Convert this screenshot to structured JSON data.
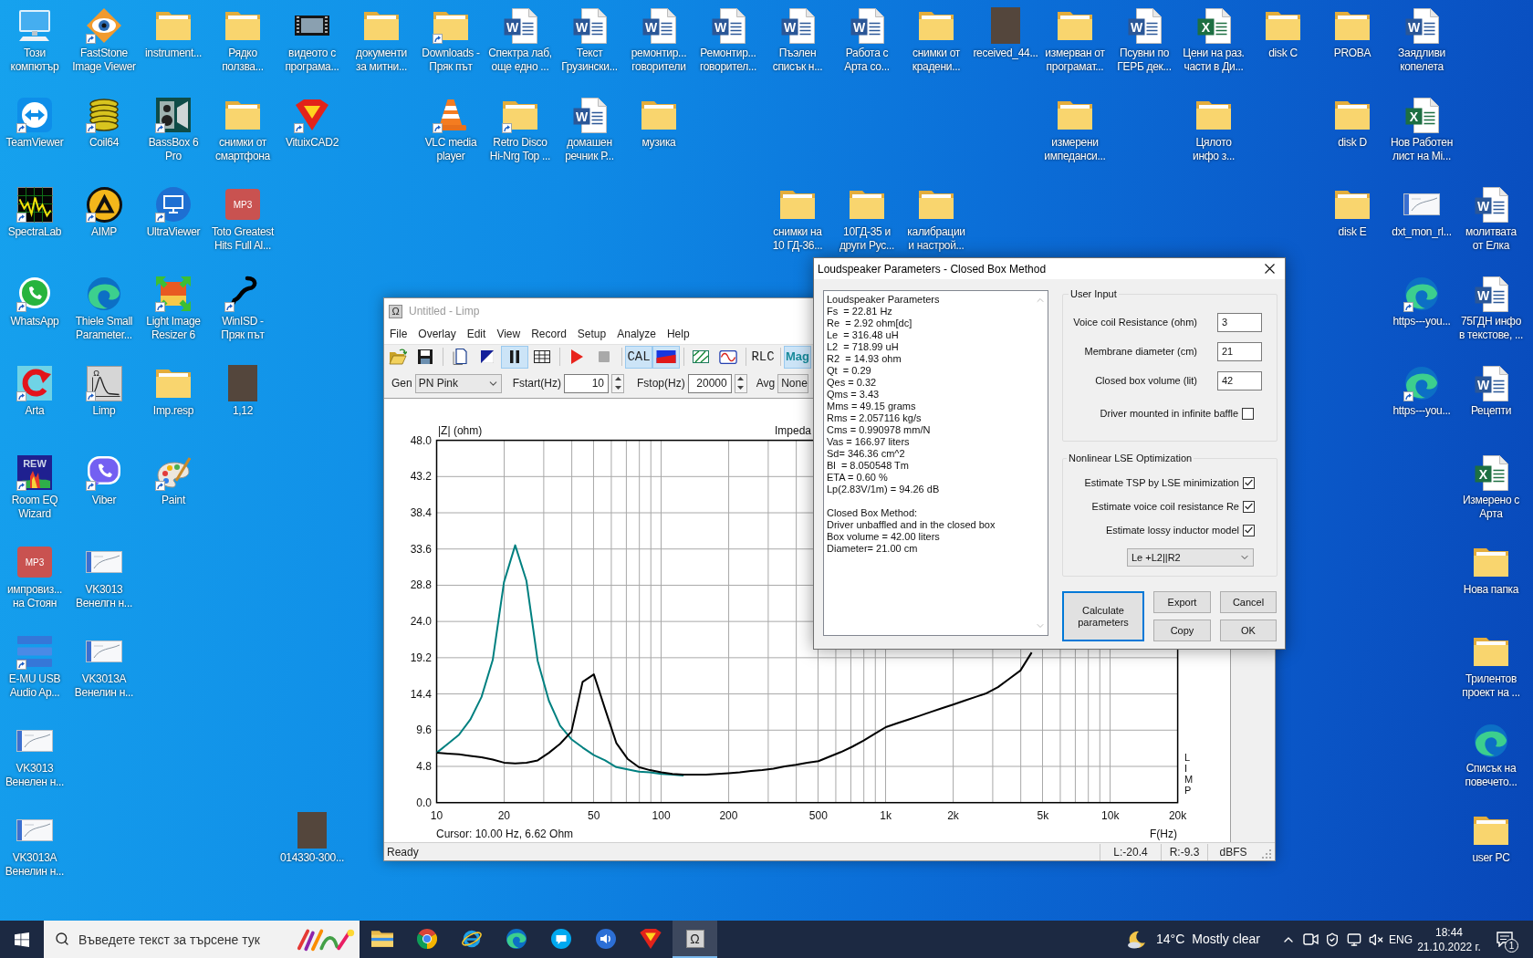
{
  "desktop": {
    "icons": [
      {
        "label_lines": [
          "Този",
          "компютър"
        ],
        "kind": "computer",
        "shortcut": false
      },
      {
        "label_lines": [
          "FastStone",
          "Image Viewer"
        ],
        "kind": "eye",
        "shortcut": true
      },
      {
        "label_lines": [
          "instrument..."
        ],
        "kind": "folder",
        "shortcut": false
      },
      {
        "label_lines": [
          "Рядко",
          "ползва..."
        ],
        "kind": "folder",
        "shortcut": false
      },
      {
        "label_lines": [
          "видеото с",
          "програма..."
        ],
        "kind": "video",
        "shortcut": false
      },
      {
        "label_lines": [
          "документи",
          "за митни..."
        ],
        "kind": "folder",
        "shortcut": false
      },
      {
        "label_lines": [
          "Downloads -",
          "Пряк път"
        ],
        "kind": "folder",
        "shortcut": true
      },
      {
        "label_lines": [
          "Спектра лаб,",
          "още едно ..."
        ],
        "kind": "word",
        "shortcut": false,
        "badge": "W"
      },
      {
        "label_lines": [
          "Текст",
          "Грузински..."
        ],
        "kind": "word",
        "shortcut": false,
        "badge": "W"
      },
      {
        "label_lines": [
          "ремонтир...",
          "говорители"
        ],
        "kind": "word",
        "shortcut": false,
        "badge": "W"
      },
      {
        "label_lines": [
          "Ремонтир...",
          "говорител..."
        ],
        "kind": "word",
        "shortcut": false,
        "badge": "W"
      },
      {
        "label_lines": [
          "Пъэлен",
          "списък н..."
        ],
        "kind": "word",
        "shortcut": false,
        "badge": "W"
      },
      {
        "label_lines": [
          "Работа с",
          "Арта со..."
        ],
        "kind": "word",
        "shortcut": false,
        "badge": "W"
      },
      {
        "label_lines": [
          "снимки от",
          "крадени..."
        ],
        "kind": "folder",
        "shortcut": false
      },
      {
        "label_lines": [
          "received_44..."
        ],
        "kind": "photo",
        "shortcut": false
      },
      {
        "label_lines": [
          "измерван от",
          "програмат..."
        ],
        "kind": "folder",
        "shortcut": false
      },
      {
        "label_lines": [
          "Псувни по",
          "ГЕРБ дек..."
        ],
        "kind": "word",
        "shortcut": false,
        "badge": "W"
      },
      {
        "label_lines": [
          "Цени на раз.",
          "части в Ди..."
        ],
        "kind": "excel",
        "shortcut": false,
        "badge": "X"
      },
      {
        "label_lines": [
          "disk C"
        ],
        "kind": "folder",
        "shortcut": false
      },
      {
        "label_lines": [
          "PROBA"
        ],
        "kind": "folder",
        "shortcut": false
      },
      {
        "label_lines": [
          "Заядливи",
          "копелета"
        ],
        "kind": "word",
        "shortcut": false,
        "badge": "W"
      },
      {
        "label_lines": [
          "TeamViewer"
        ],
        "kind": "double-arrow",
        "shortcut": true
      },
      {
        "label_lines": [
          "Coil64"
        ],
        "kind": "coil",
        "shortcut": true
      },
      {
        "label_lines": [
          "BassBox 6",
          "Pro"
        ],
        "kind": "speaker-box",
        "shortcut": true
      },
      {
        "label_lines": [
          "снимки от",
          "смартфона"
        ],
        "kind": "folder",
        "shortcut": false
      },
      {
        "label_lines": [
          "VituixCAD2"
        ],
        "kind": "shield",
        "shortcut": true
      },
      {
        "label_lines": [
          "VLC media",
          "player"
        ],
        "kind": "cone",
        "shortcut": true
      },
      {
        "label_lines": [
          "Retro Disco",
          "Hi-Nrg Top ..."
        ],
        "kind": "folder",
        "shortcut": true
      },
      {
        "label_lines": [
          "домашен",
          "речник Р..."
        ],
        "kind": "word",
        "shortcut": false,
        "badge": "W"
      },
      {
        "label_lines": [
          "музика"
        ],
        "kind": "folder",
        "shortcut": false
      },
      {
        "label_lines": [
          "измерени",
          "импеданси..."
        ],
        "kind": "folder",
        "shortcut": false
      },
      {
        "label_lines": [
          "Цялото",
          "инфо з..."
        ],
        "kind": "folder",
        "shortcut": false
      },
      {
        "label_lines": [
          "disk D"
        ],
        "kind": "folder",
        "shortcut": false
      },
      {
        "label_lines": [
          "Нов Работен",
          "лист на Mi..."
        ],
        "kind": "excel",
        "shortcut": false,
        "badge": "X"
      },
      {
        "label_lines": [
          "SpectraLab"
        ],
        "kind": "spectrum",
        "shortcut": true
      },
      {
        "label_lines": [
          "AIMP"
        ],
        "kind": "triangle",
        "shortcut": true
      },
      {
        "label_lines": [
          "UltraViewer"
        ],
        "kind": "monitor",
        "shortcut": true
      },
      {
        "label_lines": [
          "Toto Greatest",
          "Hits Full Al..."
        ],
        "kind": "music",
        "shortcut": false,
        "badge": "MP3"
      },
      {
        "label_lines": [
          "снимки на",
          "10 ГД-36..."
        ],
        "kind": "folder",
        "shortcut": false
      },
      {
        "label_lines": [
          "10ГД-35 и",
          "други Рус..."
        ],
        "kind": "folder",
        "shortcut": false
      },
      {
        "label_lines": [
          "калибрации",
          "и настрой..."
        ],
        "kind": "folder",
        "shortcut": false
      },
      {
        "label_lines": [
          "disk E"
        ],
        "kind": "folder",
        "shortcut": false
      },
      {
        "label_lines": [
          "dxt_mon_rl..."
        ],
        "kind": "thumbnail",
        "shortcut": false
      },
      {
        "label_lines": [
          "молитвата",
          "от Елка"
        ],
        "kind": "word",
        "shortcut": false,
        "badge": "W"
      },
      {
        "label_lines": [
          "WhatsApp"
        ],
        "kind": "chat",
        "shortcut": true
      },
      {
        "label_lines": [
          "Thiele Small",
          "Parameter..."
        ],
        "kind": "swirl",
        "shortcut": false
      },
      {
        "label_lines": [
          "Light Image",
          "Resizer 6"
        ],
        "kind": "resize",
        "shortcut": true
      },
      {
        "label_lines": [
          "WinISD -",
          "Пряк път"
        ],
        "kind": "squiggle",
        "shortcut": true
      },
      {
        "label_lines": [
          "https---you..."
        ],
        "kind": "swirl",
        "shortcut": true
      },
      {
        "label_lines": [
          "75ГДН инфо",
          "в текстове, ..."
        ],
        "kind": "word",
        "shortcut": false,
        "badge": "W"
      },
      {
        "label_lines": [
          "Arta"
        ],
        "kind": "circular-arrow",
        "shortcut": true
      },
      {
        "label_lines": [
          "Limp"
        ],
        "kind": "graph",
        "shortcut": true,
        "badge": "Ω"
      },
      {
        "label_lines": [
          "Imp.resp"
        ],
        "kind": "folder",
        "shortcut": false
      },
      {
        "label_lines": [
          "1,12"
        ],
        "kind": "photo",
        "shortcut": false
      },
      {
        "label_lines": [
          "https---you..."
        ],
        "kind": "swirl",
        "shortcut": true
      },
      {
        "label_lines": [
          "Рецепти"
        ],
        "kind": "word",
        "shortcut": false,
        "badge": "W"
      },
      {
        "label_lines": [
          "Room EQ",
          "Wizard"
        ],
        "kind": "spectrogram",
        "shortcut": true,
        "badge": "REW"
      },
      {
        "label_lines": [
          "Viber"
        ],
        "kind": "phone-bubble",
        "shortcut": true
      },
      {
        "label_lines": [
          "Paint"
        ],
        "kind": "palette",
        "shortcut": true
      },
      {
        "label_lines": [
          "Измерено с",
          "Арта"
        ],
        "kind": "excel",
        "shortcut": false,
        "badge": "X"
      },
      {
        "label_lines": [
          "импровиз...",
          "на Стоян"
        ],
        "kind": "music",
        "shortcut": false,
        "badge": "MP3"
      },
      {
        "label_lines": [
          "VK3013",
          "Венелгн н..."
        ],
        "kind": "thumbnail",
        "shortcut": false
      },
      {
        "label_lines": [
          "Нова папка"
        ],
        "kind": "folder",
        "shortcut": false
      },
      {
        "label_lines": [
          "E-MU USB",
          "Audio Ap..."
        ],
        "kind": "bars",
        "shortcut": true
      },
      {
        "label_lines": [
          "VK3013A",
          "Венелин н..."
        ],
        "kind": "thumbnail",
        "shortcut": false
      },
      {
        "label_lines": [
          "Трилентов",
          "проект на ..."
        ],
        "kind": "folder",
        "shortcut": false
      },
      {
        "label_lines": [
          "VK3013",
          "Венелен н..."
        ],
        "kind": "thumbnail",
        "shortcut": false
      },
      {
        "label_lines": [
          "Списък на",
          "повечето..."
        ],
        "kind": "swirl",
        "shortcut": false
      },
      {
        "label_lines": [
          "VK3013A",
          "Венелин н..."
        ],
        "kind": "thumbnail",
        "shortcut": false
      },
      {
        "label_lines": [
          "014330-300..."
        ],
        "kind": "photo",
        "shortcut": false
      },
      {
        "label_lines": [
          "user PC"
        ],
        "kind": "folder",
        "shortcut": false
      }
    ]
  },
  "limp_window": {
    "title": "Untitled - Limp",
    "active": false,
    "icon_symbol": "Ω",
    "menu": [
      "File",
      "Overlay",
      "Edit",
      "View",
      "Record",
      "Setup",
      "Analyze",
      "Help"
    ],
    "toolbar": [
      {
        "kind": "icon",
        "pressed": false
      },
      {
        "kind": "icon",
        "pressed": false
      },
      {
        "kind": "separator"
      },
      {
        "kind": "icon",
        "pressed": false
      },
      {
        "kind": "icon",
        "pressed": false
      },
      {
        "kind": "icon",
        "pressed": true
      },
      {
        "kind": "icon",
        "pressed": false
      },
      {
        "kind": "separator"
      },
      {
        "kind": "icon",
        "pressed": false
      },
      {
        "kind": "icon",
        "pressed": false
      },
      {
        "kind": "separator"
      },
      {
        "kind": "text",
        "label": "CAL",
        "pressed": true
      },
      {
        "kind": "icon",
        "pressed": true
      },
      {
        "kind": "separator"
      },
      {
        "kind": "icon",
        "pressed": false
      },
      {
        "kind": "icon",
        "pressed": false
      },
      {
        "kind": "separator"
      },
      {
        "kind": "text",
        "label": "RLC",
        "pressed": false
      },
      {
        "kind": "separator"
      },
      {
        "kind": "text",
        "label": "Mag",
        "pressed": true
      }
    ],
    "controls": [
      {
        "label": "Gen",
        "kind": "dropdown",
        "value": "PN Pink"
      },
      {
        "label": "Fstart(Hz)",
        "kind": "spin",
        "value": "10"
      },
      {
        "label": "Fstop(Hz)",
        "kind": "spin",
        "value": "20000"
      },
      {
        "label": "Avg",
        "kind": "dropdown",
        "value": "None"
      }
    ],
    "plot": {
      "cursor": "Cursor: 10.00 Hz, 6.62 Ohm",
      "side_label": "LIMP",
      "chart_data": {
        "type": "line",
        "title": "Impeda",
        "xlabel": "F(Hz)",
        "ylabel": "|Z| (ohm)",
        "grid": true,
        "categories": [
          "10",
          null,
          null,
          null,
          null,
          null,
          "20",
          null,
          null,
          null,
          null,
          null,
          null,
          null,
          "50",
          null,
          null,
          null,
          null,
          null,
          "100",
          null,
          null,
          null,
          null,
          null,
          "200",
          null,
          null,
          null,
          null,
          null,
          null,
          null,
          "500",
          null,
          null,
          null,
          null,
          null,
          "1k",
          null,
          null,
          null,
          null,
          null,
          "2k",
          null,
          null,
          null,
          null,
          null,
          null,
          null,
          "5k",
          null,
          null,
          null,
          null,
          null,
          "10k",
          null,
          null,
          null,
          null,
          null,
          "20k"
        ],
        "series": [
          {
            "color": "#008080",
            "values": [
              6.6,
              7.8,
              9.0,
              11.0,
              14.0,
              18.9,
              29.2,
              34.1,
              29.4,
              18.8,
              13.5,
              10.2,
              8.4,
              7.3,
              6.3,
              5.6,
              4.7,
              4.4,
              4.1,
              4.0,
              3.8,
              3.7,
              3.6,
              null,
              null,
              null,
              null,
              null,
              null,
              null,
              null,
              null,
              null,
              null,
              null,
              null,
              null,
              null,
              null,
              null,
              null,
              null,
              null,
              null,
              null,
              null,
              null,
              null,
              null,
              null,
              null,
              null,
              null,
              null,
              null,
              null,
              null,
              null,
              null,
              null,
              null,
              null,
              null,
              null,
              null,
              null,
              null
            ]
          },
          {
            "color": "#000000",
            "values": [
              6.6,
              6.5,
              6.4,
              6.2,
              6.0,
              5.7,
              5.3,
              5.2,
              5.3,
              5.6,
              6.6,
              7.8,
              9.4,
              16.0,
              17.0,
              12.4,
              7.9,
              5.8,
              4.7,
              4.3,
              4.0,
              3.8,
              3.7,
              3.7,
              3.7,
              3.8,
              3.9,
              4.0,
              4.2,
              4.3,
              4.5,
              4.8,
              5.0,
              5.3,
              5.5,
              6.1,
              6.7,
              7.4,
              8.2,
              9.1,
              10.0,
              10.5,
              11.0,
              11.5,
              12.0,
              12.5,
              13.0,
              13.5,
              14.0,
              14.5,
              15.3,
              16.4,
              17.5,
              19.9,
              null,
              null,
              null,
              null,
              null,
              null,
              null,
              null,
              null,
              null,
              null,
              null,
              null
            ]
          }
        ],
        "ylim": [
          0,
          48
        ],
        "yticks": [
          {
            "value": 0,
            "label": "0.0"
          },
          4.8,
          9.6,
          14.4,
          19.2,
          {
            "value": 24,
            "label": "24.0"
          },
          28.8,
          33.6,
          38.4,
          43.2,
          {
            "value": 48,
            "label": "48.0"
          }
        ]
      }
    },
    "status_bar": {
      "message": "Ready",
      "fields": [
        "L:-20.4",
        "R:-9.3",
        "dBFS"
      ]
    }
  },
  "dialog": {
    "title": "Loudspeaker Parameters - Closed Box Method",
    "active": true,
    "results": [
      [
        "Loudspeaker Parameters",
        "Fs  = 22.81 Hz",
        "Re  = 2.92 ohm[dc]",
        "Le  = 316.48 uH",
        "L2  = 718.99 uH",
        "R2  = 14.93 ohm",
        "Qt  = 0.29",
        "Qes = 0.32",
        "Qms = 3.43",
        "Mms = 49.15 grams",
        "Rms = 2.057116 kg/s",
        "Cms = 0.990978 mm/N",
        "Vas = 166.97 liters",
        "Sd= 346.36 cm^2",
        "Bl  = 8.050548 Tm",
        "ETA = 0.60 %",
        "Lp(2.83V/1m) = 94.26 dB"
      ],
      [
        "Closed Box Method:",
        "Driver unbaffled and in the closed box",
        "Box volume = 42.00 liters",
        "Diameter= 21.00 cm"
      ]
    ],
    "user_input": {
      "title": "User Input",
      "fields": [
        {
          "label": "Voice coil Resistance (ohm)",
          "value": "3"
        },
        {
          "label": "Membrane diameter (cm)",
          "value": "21"
        },
        {
          "label": "Closed box volume (lit)",
          "value": "42"
        }
      ],
      "options": [
        {
          "label": "Driver mounted in infinite baffle",
          "checked": false
        }
      ]
    },
    "optimization": {
      "title": "Nonlinear LSE Optimization",
      "options": [
        {
          "label": "Estimate TSP by LSE minimization",
          "checked": true
        },
        {
          "label": "Estimate voice coil resistance Re",
          "checked": true
        },
        {
          "label": "Estimate lossy inductor model",
          "checked": true
        }
      ],
      "model": "Le +L2||R2"
    },
    "buttons": [
      {
        "label": "Calculate parameters",
        "default": true
      },
      {
        "label": "Export",
        "default": false
      },
      {
        "label": "Cancel",
        "default": false
      },
      {
        "label": "Copy",
        "default": false
      },
      {
        "label": "OK",
        "default": false
      }
    ]
  },
  "taskbar": {
    "search": {
      "placeholder": "Въведете текст за търсене тук"
    },
    "apps": [
      {
        "kind": "folder",
        "active": false
      },
      {
        "kind": "ring",
        "active": false
      },
      {
        "kind": "orbit",
        "active": false
      },
      {
        "kind": "swirl",
        "active": false
      },
      {
        "kind": "bubble",
        "active": false
      },
      {
        "kind": "speaker",
        "active": false
      },
      {
        "kind": "shield",
        "active": false
      },
      {
        "kind": "symbol",
        "active": true,
        "symbol": "Ω"
      }
    ],
    "weather": {
      "temperature": "14°C",
      "condition": "Mostly clear"
    },
    "language": "ENG",
    "time": "18:44",
    "date": "21.10.2022 г.",
    "notification_count": "1"
  }
}
